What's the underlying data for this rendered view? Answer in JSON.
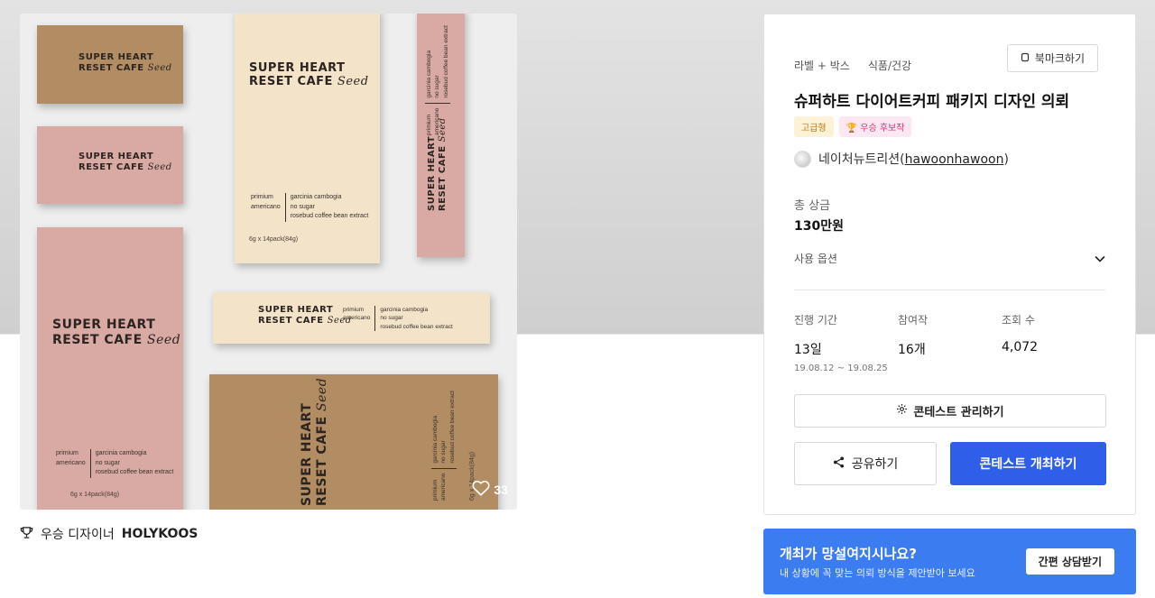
{
  "product": {
    "logo_line1": "SUPER HEART",
    "logo_line2": "RESET CAFE",
    "logo_script": "Seed",
    "spec_col1_line1": "primium",
    "spec_col1_line2": "americano",
    "spec_col2_line1": "garcinia cambogia",
    "spec_col2_line2": "no sugar",
    "spec_col2_line3": "rosebud coffee bean extract",
    "weight": "6g x 14pack(84g)",
    "like_count": "33",
    "like_icon": "heart-outline-icon"
  },
  "winner": {
    "icon": "trophy-icon",
    "label": "우승 디자이너",
    "name": "HOLYKOOS"
  },
  "panel": {
    "category1": "라벨 + 박스",
    "category2": "식품/건강",
    "bookmark_label": "북마크하기",
    "title": "슈퍼하트 다이어트커피 패키지 디자인 의뢰",
    "badge_premium": "고급형",
    "badge_award": "🏆 우승 후보작",
    "owner_name": "네이처뉴트리션",
    "owner_handle": "hawoonhawoon",
    "prize_label": "총 상금",
    "prize_value": "130만원",
    "options_label": "사용 옵션",
    "stats": {
      "period_label": "진행 기간",
      "period_value": "13일",
      "period_range": "19.08.12  ~  19.08.25",
      "entries_label": "참여작",
      "entries_value": "16개",
      "views_label": "조회 수",
      "views_value": "4,072"
    },
    "manage_label": "콘테스트 관리하기",
    "share_label": "공유하기",
    "host_label": "콘테스트 개최하기"
  },
  "banner": {
    "heading": "개최가 망설여지시나요?",
    "subtext": "내 상황에 꼭 맞는 의뢰 방식을 제안받아 보세요",
    "cta_label": "간편 상담받기"
  },
  "colors": {
    "accent": "#2f5fe8",
    "banner": "#3b7cf0",
    "kraft": "#b28d63",
    "pink": "#d9a9a4",
    "cream": "#f3e3c9"
  }
}
